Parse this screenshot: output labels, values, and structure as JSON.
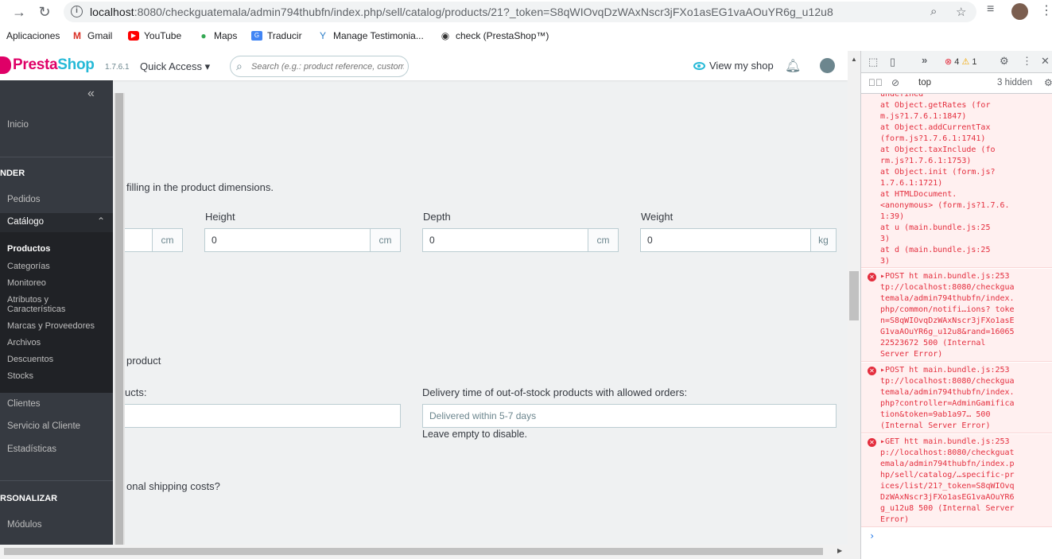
{
  "browser": {
    "url_host": "localhost",
    "url_rest": ":8080/checkguatemala/admin794thubfn/index.php/sell/catalog/products/21?_token=S8qWIOvqDzWAxNscr3jFXo1asEG1vaAOuYR6g_u12u8",
    "bookmarks": [
      "Aplicaciones",
      "Gmail",
      "YouTube",
      "Maps",
      "Traducir",
      "Manage Testimonia...",
      "check (PrestaShop™)"
    ]
  },
  "header": {
    "logo_presta": "Presta",
    "logo_shop": "Shop",
    "version": "1.7.6.1",
    "quick_access": "Quick Access ▾",
    "search_placeholder": "Search (e.g.: product reference, custome",
    "view_shop": "View my shop"
  },
  "sidebar": {
    "home": "Inicio",
    "section_sell": "NDER",
    "pedidos": "Pedidos",
    "catalogo": "Catálogo",
    "sub": [
      "Productos",
      "Categorías",
      "Monitoreo",
      "Atributos y",
      "Características",
      "Marcas y Proveedores",
      "Archivos",
      "Descuentos",
      "Stocks"
    ],
    "clientes": "Clientes",
    "servicio": "Servicio al Cliente",
    "estadisticas": "Estadísticas",
    "section_personalize": "RSONALIZAR",
    "modulos": "Módulos"
  },
  "main": {
    "dimensions_help": "filling in the product dimensions.",
    "width_unit": "cm",
    "height_label": "Height",
    "height_value": "0",
    "height_unit": "cm",
    "depth_label": "Depth",
    "depth_value": "0",
    "depth_unit": "cm",
    "weight_label": "Weight",
    "weight_value": "0",
    "weight_unit": "kg",
    "delivery_heading": "product",
    "instock_label": "ucts:",
    "outstock_label": "Delivery time of out-of-stock products with allowed orders:",
    "outstock_placeholder": "Delivered within 5-7 days",
    "leave_empty": "Leave empty to disable.",
    "shipping_costs": "onal shipping costs?"
  },
  "devtools": {
    "error_count": "4",
    "warning_count": "1",
    "context": "top",
    "hidden": "3 hidden",
    "stack_lines": [
      "undefined",
      "    at Object.getRates (for",
      "m.js?1.7.6.1:1847)",
      "    at Object.addCurrentTax",
      "(form.js?1.7.6.1:1741)",
      "    at Object.taxInclude (fo",
      "rm.js?1.7.6.1:1753)",
      "    at Object.init (form.js?",
      "1.7.6.1:1721)",
      "    at HTMLDocument.",
      "<anonymous> (form.js?1.7.6.",
      "1:39)",
      "    at u (main.bundle.js:25",
      "3)",
      "    at d (main.bundle.js:25",
      "3)"
    ],
    "errors": [
      {
        "lines": [
          "▸POST ht main.bundle.js:253",
          "tp://localhost:8080/checkgua",
          "temala/admin794thubfn/index.",
          "php/common/notifi…ions? toke",
          "n=S8qWIOvqDzWAxNscr3jFXo1asE",
          "G1vaAOuYR6g_u12u8&rand=16065",
          "22523672 500 (Internal",
          "Server Error)"
        ]
      },
      {
        "lines": [
          "▸POST ht main.bundle.js:253",
          "tp://localhost:8080/checkgua",
          "temala/admin794thubfn/index.",
          "php?controller=AdminGamifica",
          "tion&token=9ab1a97… 500",
          "(Internal Server Error)"
        ]
      },
      {
        "lines": [
          "▸GET htt main.bundle.js:253",
          "p://localhost:8080/checkguat",
          "emala/admin794thubfn/index.p",
          "hp/sell/catalog/…specific-pr",
          "ices/list/21?_token=S8qWIOvq",
          "DzWAxNscr3jFXo1asEG1vaAOuYR6",
          "g_u12u8 500 (Internal Server",
          "Error)"
        ]
      }
    ]
  }
}
